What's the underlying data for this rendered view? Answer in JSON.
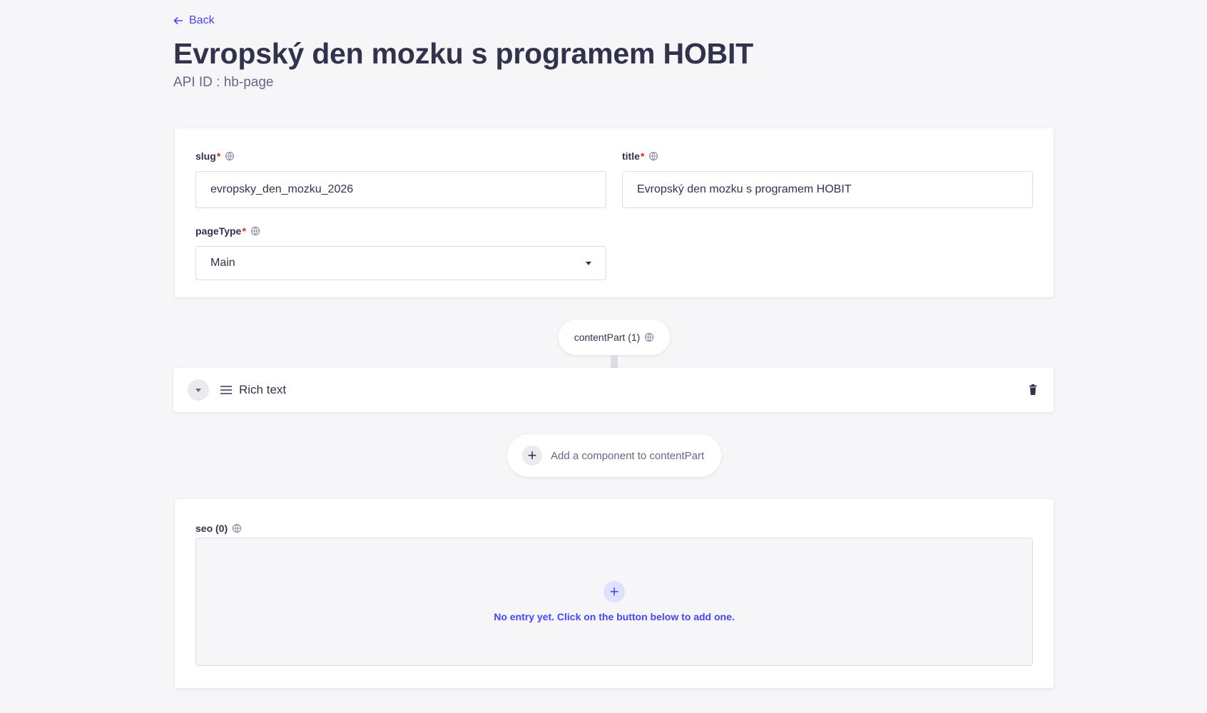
{
  "nav": {
    "back_label": "Back"
  },
  "header": {
    "title": "Evropský den mozku s programem HOBIT",
    "api_id": "API ID : hb-page"
  },
  "fields": {
    "slug": {
      "label": "slug",
      "value": "evropsky_den_mozku_2026"
    },
    "title": {
      "label": "title",
      "value": "Evropský den mozku s programem HOBIT"
    },
    "pageType": {
      "label": "pageType",
      "value": "Main"
    }
  },
  "required_mark": "*",
  "dynamic_zone": {
    "label": "contentPart (1)",
    "components": [
      {
        "name": "Rich text"
      }
    ],
    "add_label": "Add a component to contentPart"
  },
  "seo": {
    "label": "seo (0)",
    "empty_text": "No entry yet. Click on the button below to add one."
  },
  "colors": {
    "primary": "#4945ff",
    "background": "#f6f6f9",
    "required": "#d02b20"
  }
}
